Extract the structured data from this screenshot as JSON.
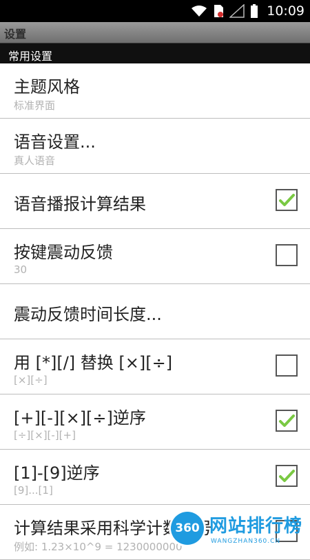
{
  "status_bar": {
    "time": "10:09",
    "icons": [
      "wifi-icon",
      "sim-card-icon",
      "signal-icon",
      "battery-icon"
    ]
  },
  "header": {
    "title": "设置"
  },
  "section": {
    "title": "常用设置"
  },
  "items": [
    {
      "title": "主题风格",
      "summary": "标准界面"
    },
    {
      "title": "语音设置...",
      "summary": "真人语音"
    },
    {
      "title": "语音播报计算结果",
      "checked": true
    },
    {
      "title": "按键震动反馈",
      "summary": "30",
      "checked": false
    },
    {
      "title": "震动反馈时间长度..."
    },
    {
      "title": "用 [*][/] 替换 [×][÷]",
      "summary": "[×][÷]",
      "checked": false
    },
    {
      "title": "[+][-][×][÷]逆序",
      "summary": "[÷][×][-][+]",
      "checked": true
    },
    {
      "title": "[1]-[9]逆序",
      "summary": "[9]...[1]",
      "checked": true
    },
    {
      "title": "计算结果采用科学计数符号",
      "summary": "例如: 1.23×10^9 = 1230000000",
      "checked": false
    }
  ],
  "watermark": {
    "logo": "360",
    "text": "网站排行榜",
    "sub": "WANGZHAN360.CN"
  },
  "colors": {
    "check": "#7ac943",
    "watermark": "#1f9be0"
  }
}
